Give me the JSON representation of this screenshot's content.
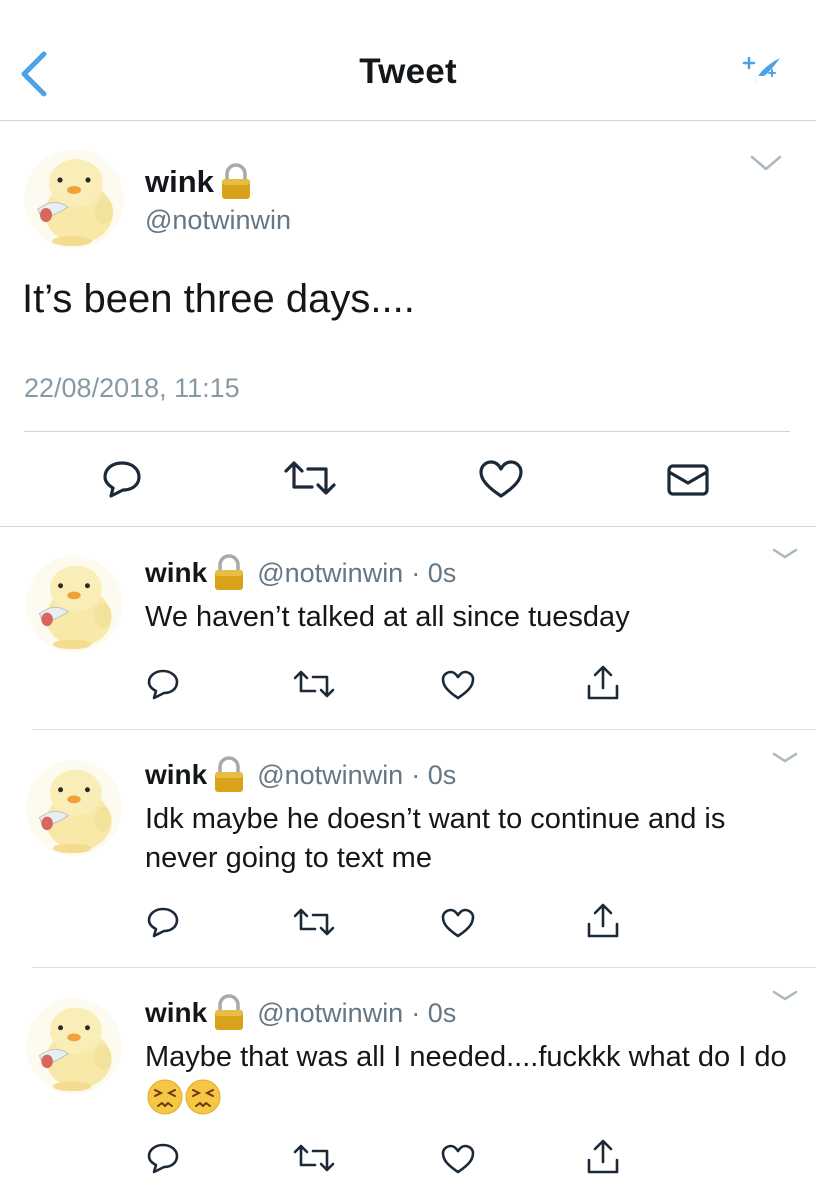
{
  "header": {
    "title": "Tweet",
    "back_icon": "chevron-left-icon",
    "compose_icon": "sparkle-icon",
    "accent_color": "#4aa3e8"
  },
  "main_tweet": {
    "display_name": "wink",
    "handle": "@notwinwin",
    "text": "It’s been three days....",
    "timestamp": "22/08/2018, 11:15",
    "actions": [
      "reply-icon",
      "retweet-icon",
      "like-icon",
      "message-icon"
    ]
  },
  "replies": [
    {
      "display_name": "wink",
      "handle": "@notwinwin",
      "time": "· 0s",
      "text": "We haven’t talked at all since tuesday",
      "emoji_count": 0
    },
    {
      "display_name": "wink",
      "handle": "@notwinwin",
      "time": "· 0s",
      "text": "Idk maybe he doesn’t want to continue and is never going to text me",
      "emoji_count": 0
    },
    {
      "display_name": "wink",
      "handle": "@notwinwin",
      "time": "· 0s",
      "text": "Maybe that was all I needed....fuckkk what do I do",
      "emoji_count": 2
    }
  ],
  "colors": {
    "text": "#14171a",
    "muted": "#657786",
    "timestamp": "#8899a6",
    "divider": "#cfd4d8",
    "lock_gold": "#d4a017"
  }
}
